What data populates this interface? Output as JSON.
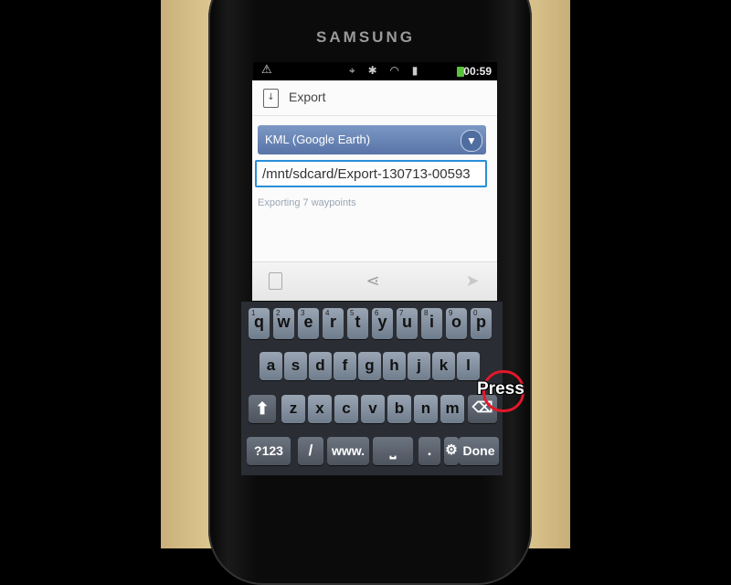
{
  "device": {
    "brand": "SAMSUNG"
  },
  "statusbar": {
    "warning_icon": "warning-icon",
    "icons": [
      "gps-icon",
      "bluetooth-icon",
      "wifi-icon",
      "signal-icon",
      "battery-icon"
    ],
    "time": "00:59"
  },
  "dialog": {
    "title": "Export",
    "format_select": {
      "value": "KML (Google Earth)"
    },
    "path_input": {
      "value": "/mnt/sdcard/Export-130713-00593"
    },
    "status_text": "Exporting 7 waypoints",
    "actions": [
      "sdcard-icon",
      "share-icon",
      "send-icon"
    ]
  },
  "keyboard": {
    "row1": [
      {
        "label": "q",
        "sub": "1"
      },
      {
        "label": "w",
        "sub": "2"
      },
      {
        "label": "e",
        "sub": "3"
      },
      {
        "label": "r",
        "sub": "4"
      },
      {
        "label": "t",
        "sub": "5"
      },
      {
        "label": "y",
        "sub": "6"
      },
      {
        "label": "u",
        "sub": "7"
      },
      {
        "label": "i",
        "sub": "8"
      },
      {
        "label": "o",
        "sub": "9"
      },
      {
        "label": "p",
        "sub": "0"
      }
    ],
    "row2": [
      "a",
      "s",
      "d",
      "f",
      "g",
      "h",
      "j",
      "k",
      "l"
    ],
    "row3": [
      "z",
      "x",
      "c",
      "v",
      "b",
      "n",
      "m"
    ],
    "shift": "⬆",
    "backspace": "⌫",
    "sym": "?123",
    "slash": "/",
    "www": "www.",
    "space": "⎵",
    "dot": ".",
    "settings": "⚙",
    "done": "Done"
  },
  "annotation": {
    "label": "Press",
    "color": "#e2182a"
  }
}
